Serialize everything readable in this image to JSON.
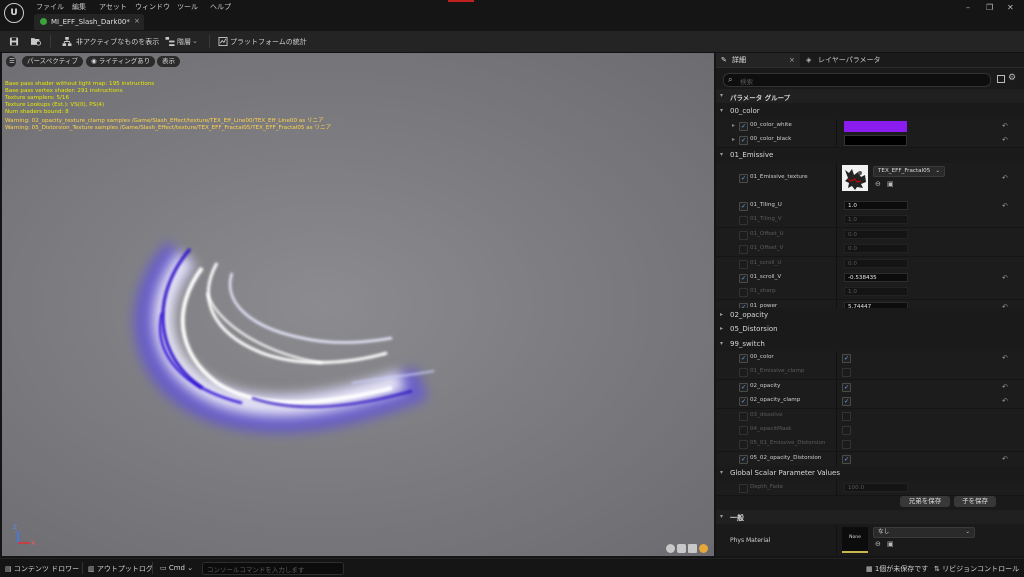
{
  "menu": {
    "logo": "U",
    "items": [
      "ファイル",
      "編集",
      "アセット",
      "ウィンドウ",
      "ツール",
      "ヘルプ"
    ],
    "window_controls": [
      "–",
      "❐",
      "✕"
    ]
  },
  "tab": {
    "label": "MI_EFF_Slash_Dark00*",
    "close": "×"
  },
  "toolbar": {
    "hide_inactive": "非アクティブなものを表示",
    "hierarchy": "階層",
    "platform_stats": "プラットフォームの統計"
  },
  "viewport": {
    "perspective": "パースペクティブ",
    "lighting": "ライティングあり",
    "show": "表示",
    "stats": [
      "Base pass shader without light map: 195 instructions",
      "Base pass vertex shader: 291 instructions",
      "Texture samplers: 5/16",
      "Texture Lookups (Est.): VS(0), PS(4)",
      "Num shaders bound: 8"
    ],
    "warnings": [
      "Warning: 02_opacity_texture_clamp samples /Game/Slash_Effect/texture/TEX_Eff_Line00/TEX_Eff_Line00 as リニア",
      "Warning: 05_Distorsion_Texture samples /Game/Slash_Effect/texture/TEX_EFF_Fractal05/TEX_EFF_Fractal05 as リニア"
    ],
    "axis": {
      "z": "Z",
      "x": "X"
    }
  },
  "details": {
    "tab_details": "詳細",
    "tab_layers": "レイヤーパラメータ",
    "search_placeholder": "検索",
    "param_group_header": "パラメータ グループ",
    "groups": {
      "g00": "00_color",
      "g01": "01_Emissive",
      "g02": "02_opacity",
      "g05": "05_Distorsion",
      "g99": "99_switch",
      "global": "Global Scalar Parameter Values",
      "general": "一般"
    },
    "color_params": {
      "white_name": "00_color_white",
      "white_color": "#8a1cf0",
      "black_name": "00_color_black",
      "black_color": "#000000"
    },
    "texture_param": {
      "name": "01_Emissive_texture",
      "asset": "TEX_EFF_Fractal05"
    },
    "emissive_rows": [
      {
        "name": "01_Tiling_U",
        "value": "1.0",
        "enabled": true
      },
      {
        "name": "01_Tiling_V",
        "value": "1.0",
        "enabled": false
      },
      {
        "name": "01_Offset_U",
        "value": "0.0",
        "enabled": false
      },
      {
        "name": "01_Offset_V",
        "value": "0.0",
        "enabled": false
      },
      {
        "name": "01_scroll_U",
        "value": "0.0",
        "enabled": false
      },
      {
        "name": "01_scroll_V",
        "value": "-0.538435",
        "enabled": true
      },
      {
        "name": "01_sharp",
        "value": "1.0",
        "enabled": false
      },
      {
        "name": "01_power",
        "value": "5.74447",
        "enabled": true
      }
    ],
    "switch_rows": [
      {
        "name": "00_color",
        "enabled": true
      },
      {
        "name": "01_Emissive_clamp",
        "enabled": false
      },
      {
        "name": "02_opacity",
        "enabled": true
      },
      {
        "name": "02_opacity_clamp",
        "enabled": true
      },
      {
        "name": "03_dissolve",
        "enabled": false
      },
      {
        "name": "04_opacitMask",
        "enabled": false
      },
      {
        "name": "05_01_Emissive_Distorsion",
        "enabled": false
      },
      {
        "name": "05_02_opacity_Distorsion",
        "enabled": true
      }
    ],
    "global_row": {
      "name": "Depth_Fade",
      "value": "100.0"
    },
    "save_sibling": "兄弟を保存",
    "save_child": "子を保存",
    "phys_material": {
      "label": "Phys Material",
      "thumb": "None",
      "value": "なし"
    }
  },
  "statusbar": {
    "content_drawer": "コンテンツ ドロワー",
    "output_log": "アウトプットログ",
    "cmd": "Cmd",
    "cmd_placeholder": "コンソールコマンドを入力します",
    "unsaved": "1個が未保存です",
    "revision": "リビジョンコントロール"
  }
}
